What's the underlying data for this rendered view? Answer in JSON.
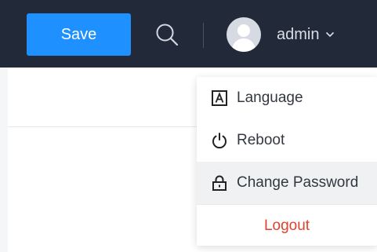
{
  "toolbar": {
    "save_label": "Save",
    "search_icon": "search-icon",
    "colors": {
      "bar": "#222a3a",
      "save": "#1e90ff"
    }
  },
  "user": {
    "name": "admin",
    "avatar_icon": "user-avatar-icon",
    "chevron_icon": "chevron-down-icon"
  },
  "dropdown": {
    "items": [
      {
        "label": "Language",
        "icon": "language-icon"
      },
      {
        "label": "Reboot",
        "icon": "power-icon"
      },
      {
        "label": "Change Password",
        "icon": "lock-icon",
        "highlighted": true
      }
    ],
    "logout_label": "Logout",
    "logout_color": "#e2412b"
  }
}
